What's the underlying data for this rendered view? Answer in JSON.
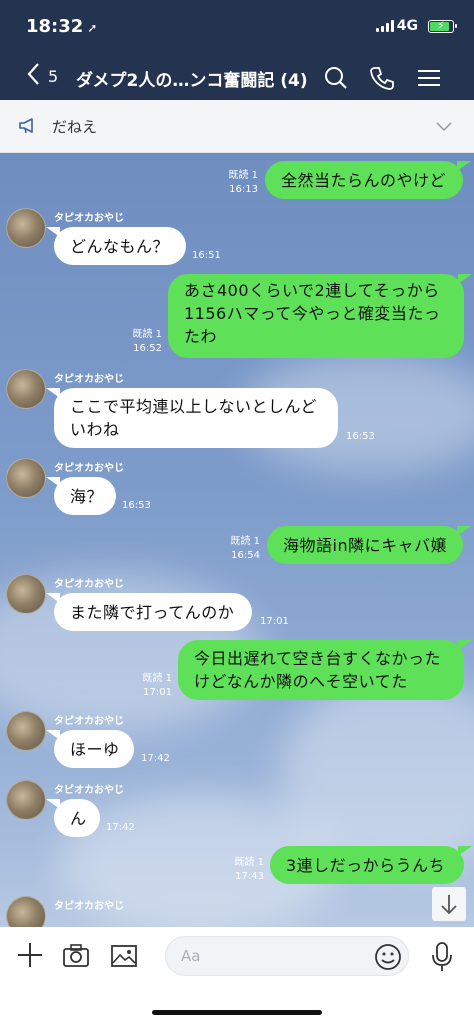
{
  "status": {
    "time": "18:32",
    "network": "4G"
  },
  "header": {
    "back_count": "5",
    "title": "ダメプ2人の…ンコ奮闘記 (4)"
  },
  "announcement": {
    "text": "だねえ"
  },
  "messages": [
    {
      "dir": "out",
      "text": "全然当たらんのやけど",
      "read": "既読 1",
      "time": "16:13"
    },
    {
      "dir": "in",
      "sender": "タピオカおやじ",
      "text": "どんなもん？",
      "time": "16:51"
    },
    {
      "dir": "out",
      "text": "あさ400くらいで2連してそっから\n1156ハマって今やっと確変当たっ\nたわ",
      "read": "既読 1",
      "time": "16:52"
    },
    {
      "dir": "in",
      "sender": "タピオカおやじ",
      "text": "ここで平均連以上しないとしんど\nいわね",
      "time": "16:53"
    },
    {
      "dir": "in",
      "sender": "タピオカおやじ",
      "text": "海？",
      "time": "16:53"
    },
    {
      "dir": "out",
      "text": "海物語in隣にキャバ嬢",
      "read": "既読 1",
      "time": "16:54"
    },
    {
      "dir": "in",
      "sender": "タピオカおやじ",
      "text": "また隣で打ってんのか",
      "time": "17:01"
    },
    {
      "dir": "out",
      "text": "今日出遅れて空き台すくなかった\nけどなんか隣のへそ空いてた",
      "read": "既読 1",
      "time": "17:01"
    },
    {
      "dir": "in",
      "sender": "タピオカおやじ",
      "text": "ほーゆ",
      "time": "17:42"
    },
    {
      "dir": "in",
      "sender": "タピオカおやじ",
      "text": "ん",
      "time": "17:42"
    },
    {
      "dir": "out",
      "text": "3連しだっからうんち",
      "read": "既読 1",
      "time": "17:43"
    },
    {
      "dir": "in",
      "sender": "タピオカおやじ"
    }
  ],
  "input": {
    "placeholder": "Aa"
  },
  "icons": [
    "location-arrow-icon",
    "signal-icon",
    "battery-icon",
    "back-chevron-icon",
    "search-icon",
    "phone-icon",
    "menu-icon",
    "megaphone-icon",
    "chevron-down-icon",
    "arrow-down-icon",
    "plus-icon",
    "camera-icon",
    "image-icon",
    "emoji-icon",
    "mic-icon"
  ]
}
